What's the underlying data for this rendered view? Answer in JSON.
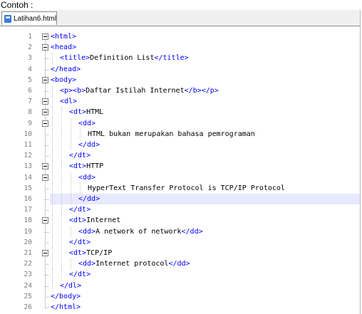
{
  "caption": "Contoh :",
  "tab": {
    "label": "Latihan6.html",
    "icon": "html-file-icon"
  },
  "highlight_line": 16,
  "lines": [
    {
      "n": "1",
      "indent": 0,
      "fold": true,
      "parts": [
        {
          "t": "tag",
          "v": "<html>"
        }
      ]
    },
    {
      "n": "2",
      "indent": 0,
      "fold": true,
      "parts": [
        {
          "t": "tag",
          "v": "<head>"
        }
      ]
    },
    {
      "n": "3",
      "indent": 2,
      "fold": false,
      "parts": [
        {
          "t": "tag",
          "v": "<title>"
        },
        {
          "t": "txt",
          "v": "Definition List"
        },
        {
          "t": "tag",
          "v": "</title>"
        }
      ]
    },
    {
      "n": "4",
      "indent": 0,
      "fold": false,
      "parts": [
        {
          "t": "tag",
          "v": "</head>"
        }
      ]
    },
    {
      "n": "5",
      "indent": 0,
      "fold": true,
      "parts": [
        {
          "t": "tag",
          "v": "<body>"
        }
      ]
    },
    {
      "n": "6",
      "indent": 2,
      "fold": false,
      "parts": [
        {
          "t": "tag",
          "v": "<p><b>"
        },
        {
          "t": "txt",
          "v": "Daftar Istilah Internet"
        },
        {
          "t": "tag",
          "v": "</b></p>"
        }
      ]
    },
    {
      "n": "7",
      "indent": 2,
      "fold": true,
      "parts": [
        {
          "t": "tag",
          "v": "<dl>"
        }
      ]
    },
    {
      "n": "8",
      "indent": 4,
      "fold": true,
      "parts": [
        {
          "t": "tag",
          "v": "<dt>"
        },
        {
          "t": "txt",
          "v": "HTML"
        }
      ]
    },
    {
      "n": "9",
      "indent": 6,
      "fold": true,
      "parts": [
        {
          "t": "tag",
          "v": "<dd>"
        }
      ]
    },
    {
      "n": "10",
      "indent": 8,
      "fold": false,
      "parts": [
        {
          "t": "txt",
          "v": "HTML bukan merupakan bahasa pemrograman"
        }
      ]
    },
    {
      "n": "11",
      "indent": 6,
      "fold": false,
      "parts": [
        {
          "t": "tag",
          "v": "</dd>"
        }
      ]
    },
    {
      "n": "12",
      "indent": 4,
      "fold": false,
      "parts": [
        {
          "t": "tag",
          "v": "</dt>"
        }
      ]
    },
    {
      "n": "13",
      "indent": 4,
      "fold": true,
      "parts": [
        {
          "t": "tag",
          "v": "<dt>"
        },
        {
          "t": "txt",
          "v": "HTTP"
        }
      ]
    },
    {
      "n": "14",
      "indent": 6,
      "fold": true,
      "parts": [
        {
          "t": "tag",
          "v": "<dd>"
        }
      ]
    },
    {
      "n": "15",
      "indent": 8,
      "fold": false,
      "parts": [
        {
          "t": "txt",
          "v": "HyperText Transfer Protocol is TCP/IP Protocol"
        }
      ]
    },
    {
      "n": "16",
      "indent": 6,
      "fold": false,
      "parts": [
        {
          "t": "tag",
          "v": "</dd>"
        }
      ]
    },
    {
      "n": "17",
      "indent": 4,
      "fold": false,
      "parts": [
        {
          "t": "tag",
          "v": "</dt>"
        }
      ]
    },
    {
      "n": "18",
      "indent": 4,
      "fold": true,
      "parts": [
        {
          "t": "tag",
          "v": "<dt>"
        },
        {
          "t": "txt",
          "v": "Internet"
        }
      ]
    },
    {
      "n": "19",
      "indent": 6,
      "fold": false,
      "parts": [
        {
          "t": "tag",
          "v": "<dd>"
        },
        {
          "t": "txt",
          "v": "A network of network"
        },
        {
          "t": "tag",
          "v": "</dd>"
        }
      ]
    },
    {
      "n": "20",
      "indent": 4,
      "fold": false,
      "parts": [
        {
          "t": "tag",
          "v": "</dt>"
        }
      ]
    },
    {
      "n": "21",
      "indent": 4,
      "fold": true,
      "parts": [
        {
          "t": "tag",
          "v": "<dt>"
        },
        {
          "t": "txt",
          "v": "TCP/IP"
        }
      ]
    },
    {
      "n": "22",
      "indent": 6,
      "fold": false,
      "parts": [
        {
          "t": "tag",
          "v": "<dd>"
        },
        {
          "t": "txt",
          "v": "Internet protocol"
        },
        {
          "t": "tag",
          "v": "</dd>"
        }
      ]
    },
    {
      "n": "23",
      "indent": 4,
      "fold": false,
      "parts": [
        {
          "t": "tag",
          "v": "</dt>"
        }
      ]
    },
    {
      "n": "24",
      "indent": 2,
      "fold": false,
      "parts": [
        {
          "t": "tag",
          "v": "</dl>"
        }
      ]
    },
    {
      "n": "25",
      "indent": 0,
      "fold": false,
      "parts": [
        {
          "t": "tag",
          "v": "</body>"
        }
      ]
    },
    {
      "n": "26",
      "indent": 0,
      "fold": false,
      "parts": [
        {
          "t": "tag",
          "v": "</html>"
        }
      ]
    }
  ]
}
